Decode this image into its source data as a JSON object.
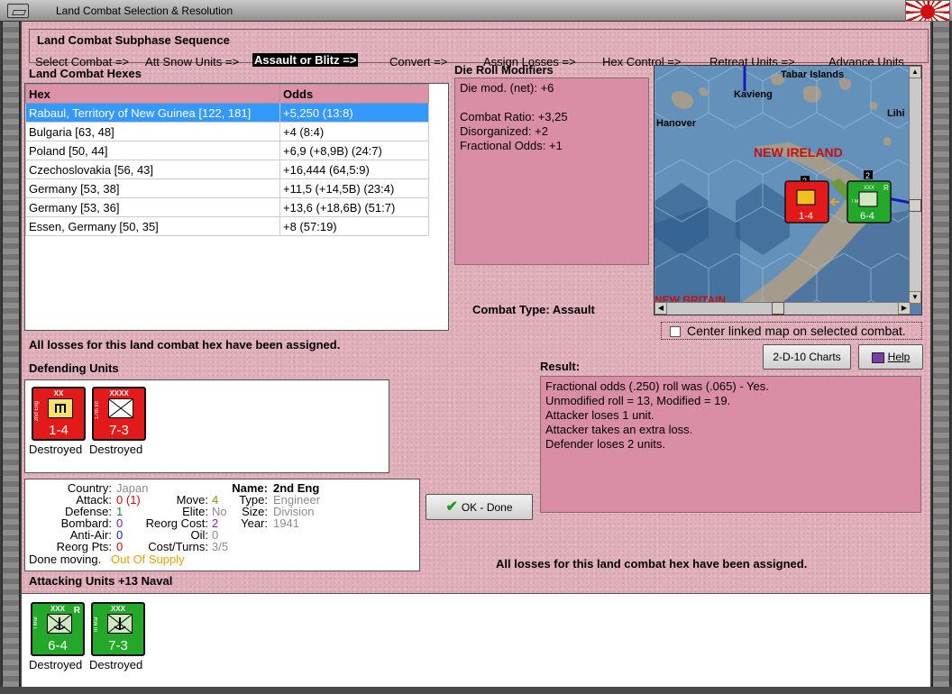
{
  "window": {
    "title": "Land Combat Selection & Resolution"
  },
  "subphase": {
    "title": "Land Combat Subphase Sequence",
    "steps": [
      "Select Combat =>",
      "Att Snow Units =>",
      "Assault or Blitz =>",
      "Convert =>",
      "Assign Losses =>",
      "Hex Control =>",
      "Retreat Units =>",
      "Advance Units"
    ],
    "active_step": "Assault or Blitz =>"
  },
  "hexes": {
    "title": "Land Combat Hexes",
    "columns": [
      "Hex",
      "Odds"
    ],
    "rows": [
      {
        "hex": "Rabaul, Territory of New Guinea [122, 181]",
        "odds": "+5,250 (13:8)"
      },
      {
        "hex": "Bulgaria [63, 48]",
        "odds": "+4 (8:4)"
      },
      {
        "hex": "Poland [50, 44]",
        "odds": "+6,9 (+8,9B) (24:7)"
      },
      {
        "hex": "Czechoslovakia [56, 43]",
        "odds": "+16,444 (64,5:9)"
      },
      {
        "hex": "Germany [53, 38]",
        "odds": "+11,5 (+14,5B) (23:4)"
      },
      {
        "hex": "Germany [53, 36]",
        "odds": "+13,6 (+18,6B) (51:7)"
      },
      {
        "hex": "Essen, Germany [50, 35]",
        "odds": "+8 (57:19)"
      }
    ]
  },
  "die_roll": {
    "title": "Die Roll Modifiers",
    "net": "Die mod. (net): +6",
    "lines": [
      "Combat Ratio: +3,25",
      "Disorganized: +2",
      "Fractional Odds: +1"
    ]
  },
  "map": {
    "labels": {
      "islands": "Tabar Islands",
      "kavieng": "Kavieng",
      "hanover": "Hanover",
      "lihir": "Lihi",
      "new_ireland": "NEW IRELAND",
      "new_britain": "NEW BRITAIN"
    },
    "stack_counts": [
      "3",
      "2"
    ],
    "units": [
      {
        "value": "1-4",
        "color": "#e21a1a"
      },
      {
        "value": "6-4",
        "color": "#23a82a",
        "corner": "R",
        "size": "XXX",
        "name": "I Mar"
      }
    ]
  },
  "combat_type": {
    "label": "Combat Type:",
    "value": "Assault"
  },
  "center_link": {
    "label": "Center linked map on selected combat.",
    "checked": false
  },
  "buttons": {
    "charts": "2-D-10 Charts",
    "help": "Help",
    "ok": "OK - Done"
  },
  "messages": {
    "defender_losses": "All losses for this land combat hex have been assigned.",
    "attacker_losses": "All losses for this land combat hex have been assigned."
  },
  "defending": {
    "title": "Defending Units",
    "units": [
      {
        "size": "XX",
        "name": "2nd Eng",
        "value": "1-4",
        "status": "Destroyed",
        "color": "#e21a1a",
        "symbol": "engineer"
      },
      {
        "size": "XXXX",
        "name": "17th Inf",
        "value": "7-3",
        "status": "Destroyed",
        "color": "#e21a1a",
        "symbol": "infantry"
      }
    ]
  },
  "unit_info": {
    "country": {
      "label": "Country:",
      "value": "Japan"
    },
    "attack": {
      "label": "Attack:",
      "value": "0",
      "extra": "(1)"
    },
    "defense": {
      "label": "Defense:",
      "value": "1"
    },
    "bombard": {
      "label": "Bombard:",
      "value": "0"
    },
    "anti_air": {
      "label": "Anti-Air:",
      "value": "0"
    },
    "reorg_pts": {
      "label": "Reorg Pts:",
      "value": "0"
    },
    "done_moving": {
      "label": "Done moving.",
      "value": "Out Of Supply"
    },
    "move": {
      "label": "Move:",
      "value": "4"
    },
    "elite": {
      "label": "Elite:",
      "value": "No"
    },
    "reorg_cost": {
      "label": "Reorg Cost:",
      "value": "2"
    },
    "oil": {
      "label": "Oil:",
      "value": "0"
    },
    "cost_turns": {
      "label": "Cost/Turns:",
      "value": "3/5"
    },
    "name": {
      "label": "Name:",
      "value": "2nd Eng"
    },
    "type": {
      "label": "Type:",
      "value": "Engineer"
    },
    "size": {
      "label": "Size:",
      "value": "Division"
    },
    "year": {
      "label": "Year:",
      "value": "1941"
    }
  },
  "result": {
    "title": "Result:",
    "lines": [
      "Fractional odds (.250) roll was (.065)  - Yes.",
      "Unmodified roll = 13, Modified = 19.",
      "Attacker loses 1 unit.",
      "Attacker takes an extra loss.",
      "Defender loses 2 units."
    ]
  },
  "attacking": {
    "title": "Attacking Units +13 Naval",
    "units": [
      {
        "size": "XXX",
        "name": "I Mar",
        "value": "6-4",
        "status": "Destroyed",
        "color": "#23a82a",
        "corner": "R"
      },
      {
        "size": "XXX",
        "name": "III Mar",
        "value": "7-3",
        "status": "Destroyed",
        "color": "#23a82a",
        "corner": ""
      }
    ]
  },
  "colors": {
    "panel": "#d98ea5",
    "background": "#e0b0bb",
    "selection": "#3399ff",
    "header": "#dc92a8"
  }
}
